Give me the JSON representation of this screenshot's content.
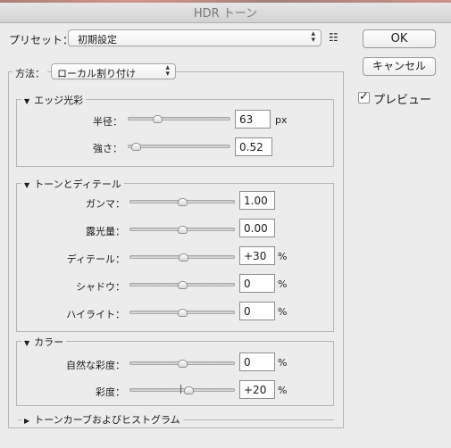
{
  "window": {
    "title": "HDR トーン"
  },
  "preset": {
    "label": "プリセット：",
    "value": "初期設定"
  },
  "buttons": {
    "ok": "OK",
    "cancel": "キャンセル"
  },
  "preview": {
    "label": "プレビュー",
    "checked": true
  },
  "method": {
    "label": "方法：",
    "value": "ローカル割り付け"
  },
  "edge_glow": {
    "title": "エッジ光彩",
    "radius": {
      "label": "半径：",
      "value": "63",
      "unit": "px"
    },
    "strength": {
      "label": "強さ：",
      "value": "0.52"
    }
  },
  "tone_detail": {
    "title": "トーンとディテール",
    "gamma": {
      "label": "ガンマ：",
      "value": "1.00"
    },
    "exposure": {
      "label": "露光量：",
      "value": "0.00"
    },
    "detail": {
      "label": "ディテール：",
      "value": "+30",
      "unit": "%"
    },
    "shadow": {
      "label": "シャドウ：",
      "value": "0",
      "unit": "%"
    },
    "highlight": {
      "label": "ハイライト：",
      "value": "0",
      "unit": "%"
    }
  },
  "color": {
    "title": "カラー",
    "vibrance": {
      "label": "自然な彩度：",
      "value": "0",
      "unit": "%"
    },
    "saturation": {
      "label": "彩度：",
      "value": "+20",
      "unit": "%"
    }
  },
  "curve": {
    "title": "トーンカーブおよびヒストグラム"
  },
  "slider_levels": {
    "radius": 0.29,
    "strength": 0.08,
    "gamma": 0.5,
    "exposure": 0.5,
    "detail": 0.51,
    "shadow": 0.5,
    "highlight": 0.5,
    "vibrance": 0.5,
    "saturation": 0.56
  }
}
